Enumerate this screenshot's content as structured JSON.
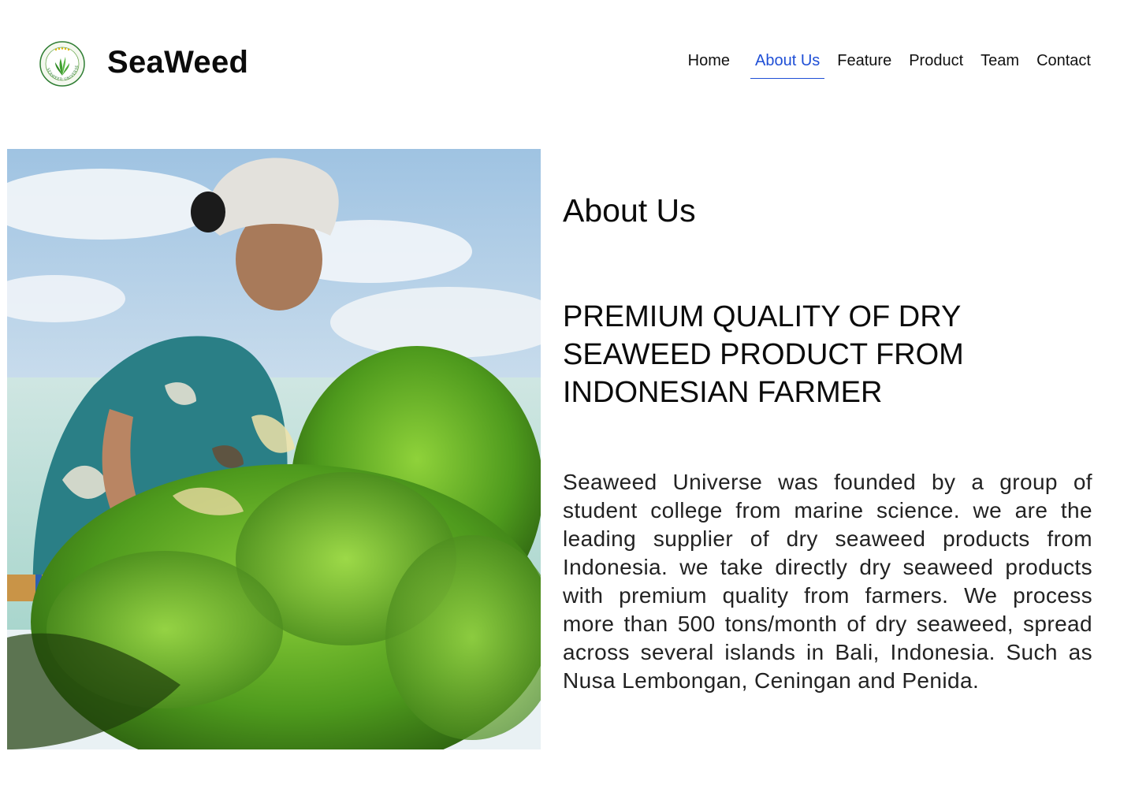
{
  "brand": {
    "name": "SeaWeed",
    "logo_text": "SEAWEED UNIVERSE",
    "logo_accent": "#2e7d32"
  },
  "nav": {
    "items": [
      {
        "label": "Home",
        "active": false
      },
      {
        "label": "About Us",
        "active": true
      },
      {
        "label": "Feature",
        "active": false
      },
      {
        "label": "Product",
        "active": false
      },
      {
        "label": "Team",
        "active": false
      },
      {
        "label": "Contact",
        "active": false
      }
    ],
    "active_color": "#1f4fd6"
  },
  "about": {
    "title": "About Us",
    "headline_lines": [
      "PREMIUM QUALITY OF DRY",
      "SEAWEED PRODUCT FROM",
      "INDONESIAN FARMER"
    ],
    "description": "Seaweed Universe was founded by a group of student college from marine science. we are the leading supplier of dry seaweed products from Indonesia. we take directly dry seaweed products with premium quality from farmers. We process more than 500 tons/month of dry seaweed, spread across several islands in Bali, Indonesia. Such as Nusa Lembongan, Ceningan and Penida."
  }
}
